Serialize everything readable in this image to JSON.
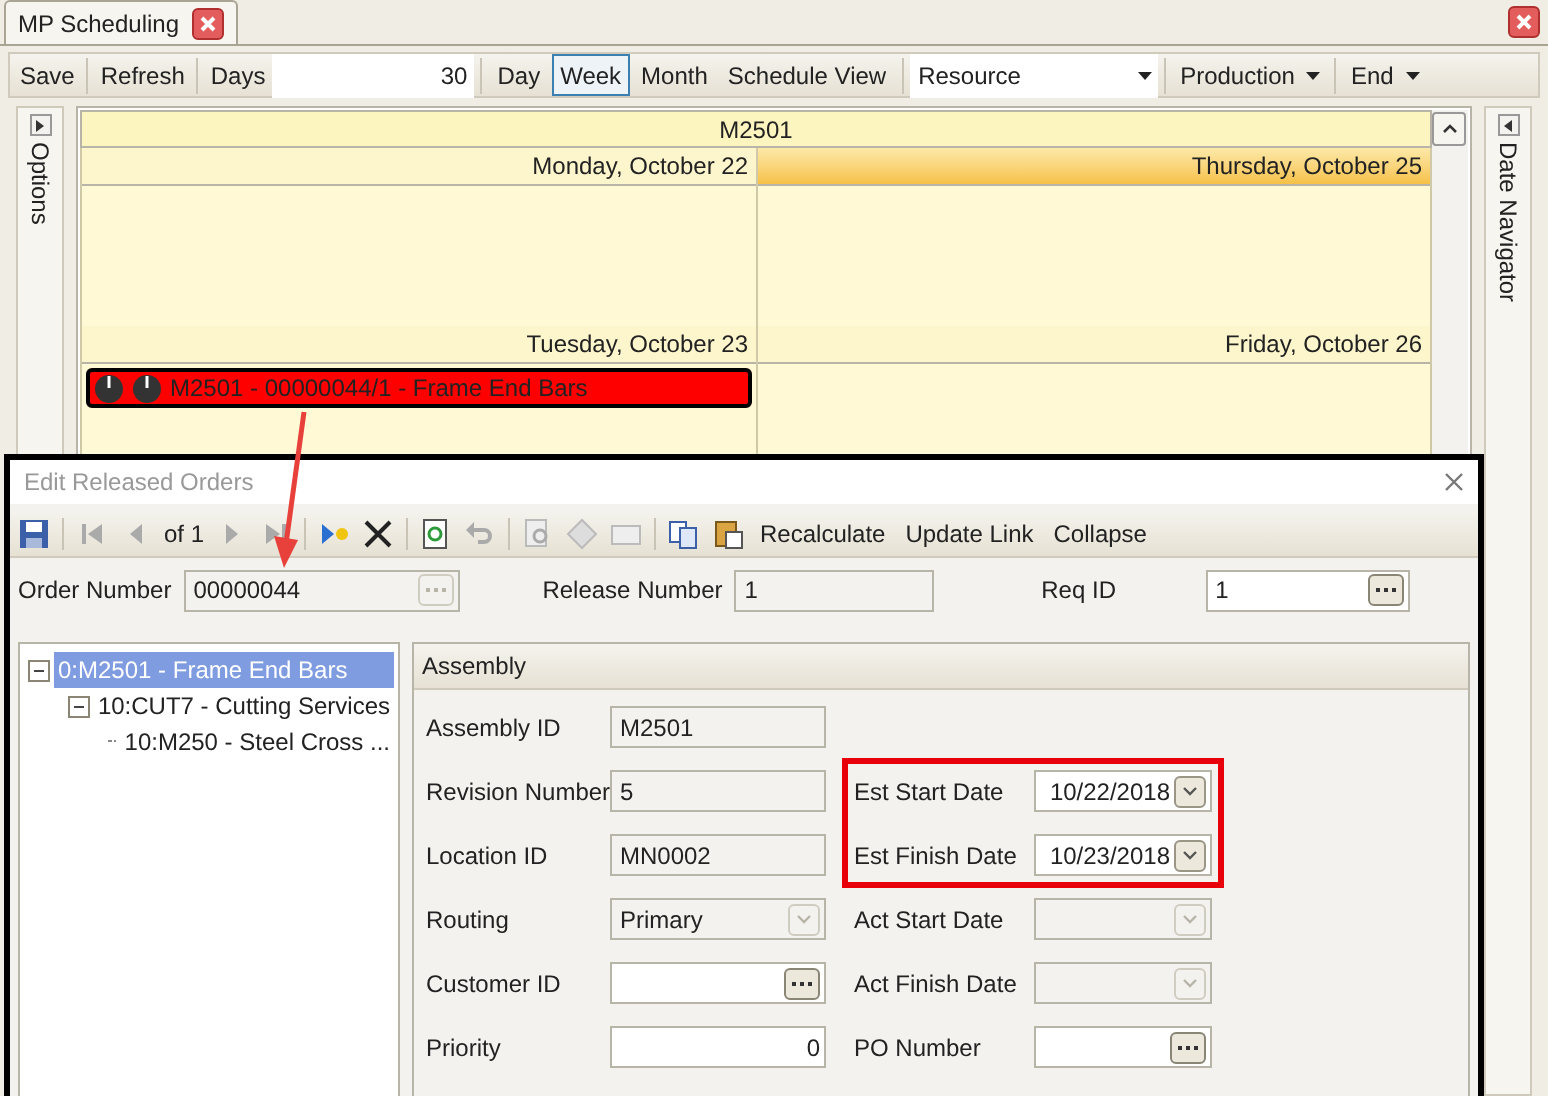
{
  "tab": {
    "title": "MP Scheduling"
  },
  "toolbar": {
    "save": "Save",
    "refresh": "Refresh",
    "days_label": "Days",
    "days_value": "30",
    "views": [
      {
        "label": "Day",
        "selected": false
      },
      {
        "label": "Week",
        "selected": true
      },
      {
        "label": "Month",
        "selected": false
      },
      {
        "label": "Schedule View",
        "selected": false
      }
    ],
    "resource": "Resource",
    "menus": [
      "Production",
      "End"
    ]
  },
  "options_panel": {
    "title": "Options"
  },
  "date_navigator": {
    "title": "Date Navigator"
  },
  "calendar": {
    "resource": "M2501",
    "days": [
      {
        "label": "Monday, October 22",
        "today": false
      },
      {
        "label": "Thursday, October 25",
        "today": true
      },
      {
        "label": "Tuesday, October 23",
        "today": false,
        "events": [
          {
            "text": "M2501 - 00000044/1 - Frame End Bars",
            "color": "#ff0000"
          }
        ]
      },
      {
        "label": "Friday, October 26",
        "today": false
      }
    ]
  },
  "dialog": {
    "title": "Edit Released Orders",
    "page": "of 1",
    "actions": [
      "Recalculate",
      "Update Link",
      "Collapse"
    ],
    "order_fields": [
      {
        "label": "Order Number",
        "value": "00000044",
        "kind": "lookup",
        "disabled": true
      },
      {
        "label": "Release Number",
        "value": "1",
        "kind": "text",
        "disabled": true
      },
      {
        "label": "Req ID",
        "value": "1",
        "kind": "lookup",
        "disabled": false
      }
    ],
    "tree": [
      {
        "label": "0:M2501 - Frame End Bars",
        "selected": true,
        "expanded": true,
        "children": [
          {
            "label": "10:CUT7 - Cutting Services",
            "selected": false,
            "expanded": true,
            "children": [
              {
                "label": "10:M250 - Steel Cross ...",
                "selected": false
              }
            ]
          }
        ]
      }
    ],
    "section": "Assembly",
    "left_fields": [
      {
        "label": "Assembly ID",
        "value": "M2501",
        "kind": "text",
        "disabled": true
      },
      {
        "label": "Revision Number",
        "value": "5",
        "kind": "text",
        "disabled": true
      },
      {
        "label": "Location ID",
        "value": "MN0002",
        "kind": "text",
        "disabled": true
      },
      {
        "label": "Routing",
        "value": "Primary",
        "kind": "combo",
        "disabled": true
      },
      {
        "label": "Customer ID",
        "kind": "lookup",
        "disabled": false
      },
      {
        "label": "Priority",
        "value": "0",
        "kind": "number",
        "disabled": false
      }
    ],
    "highlighted_fields": [
      {
        "label": "Est Start Date",
        "value": "10/22/2018",
        "kind": "date",
        "disabled": false
      },
      {
        "label": "Est Finish Date",
        "value": "10/23/2018",
        "kind": "date",
        "disabled": false
      }
    ],
    "right_fields": [
      {
        "label": "Act Start Date",
        "kind": "date",
        "disabled": true
      },
      {
        "label": "Act Finish Date",
        "kind": "date",
        "disabled": true
      },
      {
        "label": "PO Number",
        "kind": "lookup",
        "disabled": false
      }
    ]
  }
}
